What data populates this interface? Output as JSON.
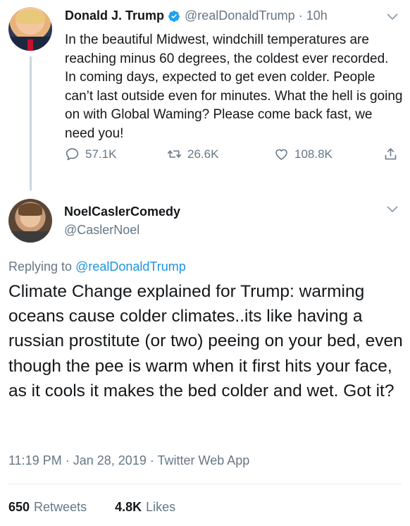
{
  "original_tweet": {
    "author_name": "Donald J. Trump",
    "handle": "@realDonaldTrump",
    "separator": "·",
    "time": "10h",
    "verified": true,
    "text": "In the beautiful Midwest, windchill temperatures are reaching minus 60 degrees, the coldest ever recorded. In coming days, expected to get even colder. People can’t last outside even for minutes. What the hell is going on with Global Waming? Please come back fast, we need you!",
    "actions": {
      "replies": "57.1K",
      "retweets": "26.6K",
      "likes": "108.8K"
    }
  },
  "reply_tweet": {
    "author_name": "NoelCaslerComedy",
    "handle": "@CaslerNoel",
    "replying_prefix": "Replying to",
    "replying_to": "@realDonaldTrump",
    "text": "Climate Change explained for Trump: warming oceans cause colder climates..its like having a russian prostitute (or two) peeing on your bed, even though the pee is warm when it first hits your face, as it cools it makes the bed colder and wet. Got it?",
    "meta": {
      "time": "11:19 PM",
      "date": "Jan 28, 2019",
      "source": "Twitter Web App",
      "separator": "·"
    },
    "stats": {
      "retweets_count": "650",
      "retweets_label": "Retweets",
      "likes_count": "4.8K",
      "likes_label": "Likes"
    }
  },
  "icons": {
    "verified": "verified-badge-icon",
    "reply": "reply-bubble-icon",
    "retweet": "retweet-icon",
    "like": "heart-icon",
    "share": "share-icon",
    "menu": "chevron-down-icon"
  },
  "colors": {
    "link": "#1b95e0",
    "secondary_text": "#657786",
    "primary_text": "#14171a",
    "verified": "#1da1f2"
  }
}
